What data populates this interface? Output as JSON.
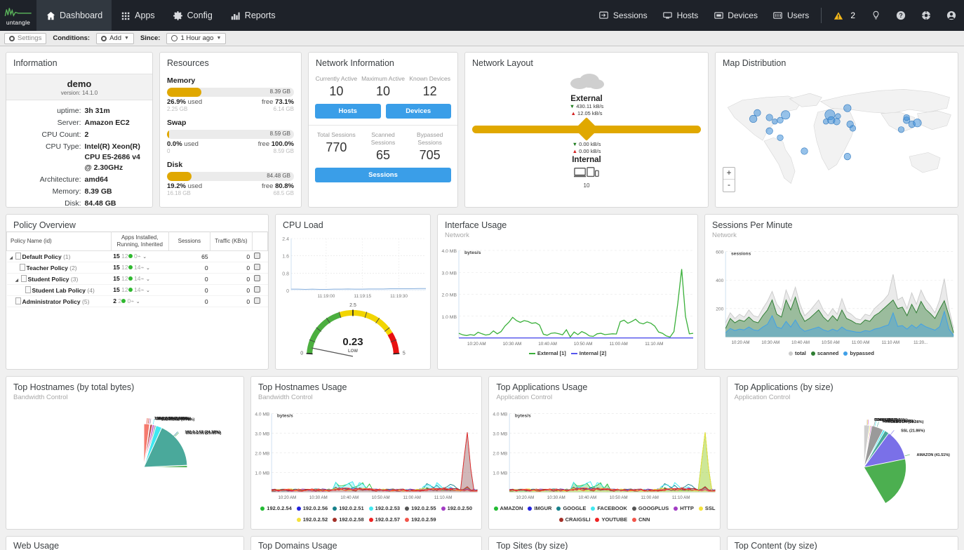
{
  "nav": {
    "brand": "untangle",
    "items": [
      {
        "label": "Dashboard",
        "icon": "home-icon",
        "active": true
      },
      {
        "label": "Apps",
        "icon": "grid-icon",
        "active": false
      },
      {
        "label": "Config",
        "icon": "gear-icon",
        "active": false
      },
      {
        "label": "Reports",
        "icon": "bars-icon",
        "active": false
      }
    ],
    "right_items": [
      {
        "label": "Sessions",
        "icon": "sessions-icon"
      },
      {
        "label": "Hosts",
        "icon": "hosts-icon"
      },
      {
        "label": "Devices",
        "icon": "devices-icon"
      },
      {
        "label": "Users",
        "icon": "users-icon"
      }
    ],
    "alert_count": "2",
    "alert_icon": "warning-icon",
    "bulb_icon": "lightbulb-icon",
    "help_icon": "question-icon",
    "support_icon": "lifering-icon",
    "account_icon": "account-icon"
  },
  "toolbar": {
    "settings_label": "Settings",
    "conditions_label": "Conditions:",
    "add_label": "Add",
    "since_label": "Since:",
    "since_value": "1 Hour ago"
  },
  "information": {
    "title": "Information",
    "hostname": "demo",
    "version": "version: 14.1.0",
    "rows": [
      {
        "key": "uptime:",
        "value": "3h 31m"
      },
      {
        "key": "Server:",
        "value": "Amazon EC2"
      },
      {
        "key": "CPU Count:",
        "value": "2"
      },
      {
        "key": "CPU Type:",
        "value": "Intel(R) Xeon(R) CPU E5-2686 v4 @ 2.30GHz"
      },
      {
        "key": "Architecture:",
        "value": "amd64"
      },
      {
        "key": "Memory:",
        "value": "8.39 GB"
      },
      {
        "key": "Disk:",
        "value": "84.48 GB"
      }
    ]
  },
  "resources": {
    "title": "Resources",
    "groups": [
      {
        "name": "Memory",
        "total": "8.39 GB",
        "pct": 26.9,
        "used_pct": "26.9%",
        "used_word": "used",
        "free_word": "free",
        "free_pct": "73.1%",
        "used_abs": "2.25 GB",
        "free_abs": "6.14 GB"
      },
      {
        "name": "Swap",
        "total": "8.59 GB",
        "pct": 0.0,
        "used_pct": "0.0%",
        "used_word": "used",
        "free_word": "free",
        "free_pct": "100.0%",
        "used_abs": "0",
        "free_abs": "8.59 GB"
      },
      {
        "name": "Disk",
        "total": "84.48 GB",
        "pct": 19.2,
        "used_pct": "19.2%",
        "used_word": "used",
        "free_word": "free",
        "free_pct": "80.8%",
        "used_abs": "16.18 GB",
        "free_abs": "68.5 GB"
      }
    ]
  },
  "network_information": {
    "title": "Network Information",
    "top_stats": [
      {
        "label": "Currently Active",
        "value": "10"
      },
      {
        "label": "Maximum Active",
        "value": "10"
      },
      {
        "label": "Known Devices",
        "value": "12"
      }
    ],
    "hosts_button": "Hosts",
    "devices_button": "Devices",
    "bottom_stats": [
      {
        "label": "Total Sessions",
        "value": "770"
      },
      {
        "label": "Scanned Sessions",
        "value": "65"
      },
      {
        "label": "Bypassed Sessions",
        "value": "705"
      }
    ],
    "sessions_button": "Sessions"
  },
  "network_layout": {
    "title": "Network Layout",
    "external_label": "External",
    "external_down": "430.11 kB/s",
    "external_up": "12.05 kB/s",
    "internal_label": "Internal",
    "internal_down": "0.00 kB/s",
    "internal_up": "0.00 kB/s",
    "device_count": "10",
    "cloud_icon": "cloud-icon",
    "devices_icon": "devices-icon"
  },
  "map": {
    "title": "Map Distribution",
    "zoom_in": "+",
    "zoom_out": "-"
  },
  "policy_overview": {
    "title": "Policy Overview",
    "columns": [
      "Policy Name (id)",
      "Apps Installed, Running, Inherited",
      "Sessions",
      "Traffic (KB/s)",
      ""
    ],
    "rows": [
      {
        "name": "Default Policy",
        "id": "(1)",
        "indent": 0,
        "expander": true,
        "installed": "15",
        "running": "12",
        "inherited": "0",
        "sessions": "65",
        "traffic": "0"
      },
      {
        "name": "Teacher Policy",
        "id": "(2)",
        "indent": 1,
        "expander": false,
        "installed": "15",
        "running": "12",
        "inherited": "14",
        "sessions": "0",
        "traffic": "0"
      },
      {
        "name": "Student Policy",
        "id": "(3)",
        "indent": 1,
        "expander": true,
        "installed": "15",
        "running": "12",
        "inherited": "14",
        "sessions": "0",
        "traffic": "0"
      },
      {
        "name": "Student Lab Policy",
        "id": "(4)",
        "indent": 2,
        "expander": false,
        "installed": "15",
        "running": "12",
        "inherited": "14",
        "sessions": "0",
        "traffic": "0"
      },
      {
        "name": "Administrator Policy",
        "id": "(5)",
        "indent": 0,
        "expander": false,
        "installed": "2",
        "running": "2",
        "inherited": "0",
        "sessions": "0",
        "traffic": "0"
      }
    ]
  },
  "cpu_load": {
    "title": "CPU Load",
    "gauge_value": "0.23",
    "gauge_state": "LOW",
    "gauge_ticks": [
      "0",
      "2.5",
      "5"
    ]
  },
  "interface_usage": {
    "title": "Interface Usage",
    "subtitle": "Network"
  },
  "sessions_per_minute": {
    "title": "Sessions Per Minute",
    "subtitle": "Network"
  },
  "top_hostnames_pie": {
    "title": "Top Hostnames (by total bytes)",
    "subtitle": "Bandwidth Control"
  },
  "top_hostnames_usage": {
    "title": "Top Hostnames Usage",
    "subtitle": "Bandwidth Control"
  },
  "top_applications_usage": {
    "title": "Top Applications Usage",
    "subtitle": "Application Control"
  },
  "top_applications_pie": {
    "title": "Top Applications (by size)",
    "subtitle": "Application Control"
  },
  "bottom_row": [
    {
      "title": "Web Usage"
    },
    {
      "title": "Top Domains Usage"
    },
    {
      "title": "Top Sites (by size)"
    },
    {
      "title": "Top Content (by size)"
    }
  ],
  "chart_data": [
    {
      "id": "cpu_load_line",
      "type": "line",
      "title": "CPU Load",
      "ylabel": "",
      "ylim": [
        0,
        2.4
      ],
      "yticks": [
        0,
        0.8,
        1.6,
        2.4
      ],
      "ytick_labels": [
        "0",
        "0.8",
        "1.6",
        "2.4"
      ],
      "xtick_labels": [
        "11:19:00",
        "11:19:15",
        "11:19:30"
      ],
      "series": [
        {
          "name": "load",
          "color": "#7fa8d8",
          "values": [
            0.06,
            0.06,
            0.05,
            0.06,
            0.05,
            0.05,
            0.06,
            0.06,
            0.07,
            0.06,
            0.06,
            0.07,
            0.07,
            0.07,
            0.08,
            0.08,
            0.08,
            0.08,
            0.09,
            0.09
          ]
        }
      ],
      "grid": true
    },
    {
      "id": "cpu_load_gauge",
      "type": "gauge",
      "title": "CPU Load Gauge",
      "value": 0.23,
      "value_label": "0.23",
      "state": "LOW",
      "min": 0,
      "max": 5,
      "ticks": [
        0,
        2.5,
        5
      ],
      "bands": [
        {
          "from": 0,
          "to": 2.0,
          "color": "#4caf3f"
        },
        {
          "from": 2.0,
          "to": 4.2,
          "color": "#f2d500"
        },
        {
          "from": 4.2,
          "to": 5,
          "color": "#e81010"
        }
      ]
    },
    {
      "id": "interface_usage",
      "type": "line",
      "title": "Interface Usage",
      "subtitle": "Network",
      "ylabel": "bytes/s",
      "ylim": [
        0,
        4000000
      ],
      "ytick_labels": [
        "1.0 MB",
        "2.0 MB",
        "3.0 MB",
        "4.0 MB"
      ],
      "xtick_labels": [
        "10:20 AM",
        "10:30 AM",
        "10:40 AM",
        "10:50 AM",
        "11:00 AM",
        "11:10 AM"
      ],
      "legend_position": "bottom",
      "series": [
        {
          "name": "External [1]",
          "color": "#3ab03a",
          "values": [
            0.22,
            0.15,
            0.12,
            0.16,
            0.13,
            0.27,
            0.2,
            0.14,
            0.17,
            0.33,
            0.2,
            0.3,
            0.55,
            0.72,
            0.95,
            0.8,
            0.72,
            0.8,
            0.76,
            0.68,
            0.7,
            0.6,
            0.18,
            0.13,
            0.22,
            0.24,
            0.2,
            0.15,
            0.38,
            0.05,
            0.28,
            0.16,
            0.3,
            0.22,
            0.1,
            0.08,
            0.2,
            0.22,
            0.16,
            0.18,
            0.2,
            0.19,
            0.75,
            0.82,
            0.68,
            0.76,
            0.86,
            0.7,
            0.65,
            0.74,
            0.68,
            0.55,
            0.28,
            0.22,
            0.1,
            0.05,
            0.3,
            1.6,
            3.15,
            1.0,
            0.2,
            0.22
          ]
        },
        {
          "name": "Internal [2]",
          "color": "#5555ee",
          "values": [
            0.01,
            0.01,
            0.01,
            0.01,
            0.01,
            0.01,
            0.01,
            0.01,
            0.01,
            0.01,
            0.01,
            0.01,
            0.01,
            0.01,
            0.01,
            0.01,
            0.01,
            0.01,
            0.01,
            0.01,
            0.01,
            0.01,
            0.01,
            0.01,
            0.01,
            0.01,
            0.01,
            0.01,
            0.01,
            0.01,
            0.01,
            0.01,
            0.01,
            0.01,
            0.01,
            0.01,
            0.01,
            0.01,
            0.01,
            0.01,
            0.01,
            0.01,
            0.01,
            0.01,
            0.01,
            0.01,
            0.01,
            0.01,
            0.01,
            0.01,
            0.01,
            0.01,
            0.01,
            0.01,
            0.01,
            0.01,
            0.01,
            0.01,
            0.01,
            0.01,
            0.01,
            0.01
          ]
        }
      ]
    },
    {
      "id": "sessions_per_minute",
      "type": "area",
      "title": "Sessions Per Minute",
      "subtitle": "Network",
      "ylabel": "sessions",
      "ylim": [
        0,
        600
      ],
      "ytick_labels": [
        "200",
        "400",
        "600"
      ],
      "xtick_labels": [
        "10:20 AM",
        "10:30 AM",
        "10:40 AM",
        "10:50 AM",
        "11:00 AM",
        "11:10 AM",
        "11:20..."
      ],
      "legend_position": "bottom",
      "series": [
        {
          "name": "total",
          "color": "#cccccc",
          "values": [
            100,
            170,
            130,
            160,
            140,
            190,
            150,
            140,
            200,
            250,
            320,
            230,
            190,
            330,
            250,
            350,
            230,
            150,
            180,
            220,
            260,
            190,
            150,
            200,
            160,
            270,
            180,
            160,
            130,
            120,
            160,
            150,
            200,
            230,
            260,
            300,
            440,
            260,
            280,
            200,
            310,
            230,
            330,
            260,
            220,
            170,
            260,
            410,
            200,
            60
          ]
        },
        {
          "name": "scanned",
          "color": "#2e7d32",
          "values": [
            60,
            130,
            100,
            120,
            110,
            140,
            110,
            100,
            150,
            190,
            260,
            160,
            140,
            260,
            190,
            280,
            170,
            110,
            130,
            160,
            190,
            140,
            110,
            150,
            115,
            190,
            130,
            115,
            95,
            90,
            120,
            110,
            150,
            170,
            200,
            230,
            260,
            200,
            210,
            150,
            230,
            170,
            250,
            195,
            165,
            130,
            195,
            255,
            150,
            30
          ]
        },
        {
          "name": "bypassed",
          "color": "#3fa0e8",
          "values": [
            30,
            60,
            45,
            55,
            50,
            70,
            50,
            45,
            70,
            90,
            150,
            70,
            60,
            110,
            70,
            120,
            65,
            40,
            50,
            60,
            70,
            50,
            40,
            55,
            42,
            70,
            48,
            42,
            35,
            33,
            45,
            40,
            55,
            62,
            75,
            85,
            170,
            75,
            80,
            55,
            85,
            62,
            92,
            72,
            60,
            48,
            72,
            180,
            55,
            10
          ]
        }
      ]
    },
    {
      "id": "top_hostnames_pie",
      "type": "pie",
      "title": "Top Hostnames (by total bytes)",
      "subtitle": "Bandwidth Control",
      "slices": [
        {
          "label": "192.0.2.51",
          "pct": 25.15,
          "color": "#4caf50"
        },
        {
          "label": "192.0.2.57",
          "pct": 24.34,
          "color": "#7a70e8"
        },
        {
          "label": "192.0.2.53",
          "pct": 24.23,
          "color": "#4aa99b"
        },
        {
          "label": "192.0.2.52",
          "pct": 6.79,
          "color": "#3fe8f0"
        },
        {
          "label": "192.0.2.58",
          "pct": 4.58,
          "color": "#9a9a9a"
        },
        {
          "label": "192.0.2.50",
          "pct": 3.97,
          "color": "#cc55cc"
        },
        {
          "label": "192.0.2.56",
          "pct": 3.2,
          "color": "#f2e54a"
        },
        {
          "label": "192.0.2.55",
          "pct": 3.18,
          "color": "#b5413f"
        },
        {
          "label": "192.0.2.54",
          "pct": 2.32,
          "color": "#e8403a"
        },
        {
          "label": "192.0.2.59",
          "pct": 2.14,
          "color": "#f57a6e"
        }
      ]
    },
    {
      "id": "top_hostnames_usage",
      "type": "line",
      "title": "Top Hostnames Usage",
      "subtitle": "Bandwidth Control",
      "ylabel": "bytes/s",
      "ylim": [
        0,
        4000000
      ],
      "ytick_labels": [
        "1.0 MB",
        "2.0 MB",
        "3.0 MB",
        "4.0 MB"
      ],
      "xtick_labels": [
        "10:20 AM",
        "10:30 AM",
        "10:40 AM",
        "10:50 AM",
        "11:00 AM",
        "11:10 AM"
      ],
      "legend_position": "bottom",
      "series": [
        {
          "name": "192.0.2.54",
          "color": "#22bb33"
        },
        {
          "name": "192.0.2.56",
          "color": "#2222dd"
        },
        {
          "name": "192.0.2.51",
          "color": "#17808a"
        },
        {
          "name": "192.0.2.53",
          "color": "#40e8f0"
        },
        {
          "name": "192.0.2.55",
          "color": "#555555"
        },
        {
          "name": "192.0.2.50",
          "color": "#a23cc4"
        },
        {
          "name": "192.0.2.52",
          "color": "#f5e23a"
        },
        {
          "name": "192.0.2.58",
          "color": "#a33028"
        },
        {
          "name": "192.0.2.57",
          "color": "#ee2222"
        },
        {
          "name": "192.0.2.59",
          "color": "#f2554a"
        }
      ]
    },
    {
      "id": "top_applications_usage",
      "type": "line",
      "title": "Top Applications Usage",
      "subtitle": "Application Control",
      "ylabel": "bytes/s",
      "ylim": [
        0,
        4000000
      ],
      "ytick_labels": [
        "1.0 MB",
        "2.0 MB",
        "3.0 MB",
        "4.0 MB"
      ],
      "xtick_labels": [
        "10:20 AM",
        "10:30 AM",
        "10:40 AM",
        "10:50 AM",
        "11:00 AM",
        "11:10 AM"
      ],
      "legend_position": "bottom",
      "series": [
        {
          "name": "AMAZON",
          "color": "#22bb33"
        },
        {
          "name": "IMGUR",
          "color": "#2222dd"
        },
        {
          "name": "GOOGLE",
          "color": "#17808a"
        },
        {
          "name": "FACEBOOK",
          "color": "#40e8f0"
        },
        {
          "name": "GOOGPLUS",
          "color": "#555555"
        },
        {
          "name": "HTTP",
          "color": "#a23cc4"
        },
        {
          "name": "SSL",
          "color": "#f5e23a"
        },
        {
          "name": "CRAIGSLI",
          "color": "#a33028"
        },
        {
          "name": "YOUTUBE",
          "color": "#ee2222"
        },
        {
          "name": "CNN",
          "color": "#f2554a"
        }
      ]
    },
    {
      "id": "top_applications_pie",
      "type": "pie",
      "title": "Top Applications (by size)",
      "subtitle": "Application Control",
      "slices": [
        {
          "label": "AMAZON",
          "pct": 41.51,
          "color": "#4caf50"
        },
        {
          "label": "SSL",
          "pct": 21.86,
          "color": "#7a70e8"
        },
        {
          "label": "FACEBOOK",
          "pct": 10.08,
          "color": "#4aa99b"
        },
        {
          "label": "CRAIGSLI",
          "pct": 8.33,
          "color": "#3fe8f0"
        },
        {
          "label": "GOOGLE",
          "pct": 7.62,
          "color": "#9a9a9a"
        },
        {
          "label": "CNN",
          "pct": 3.04,
          "color": "#cc55cc"
        },
        {
          "label": "YOUTUBE",
          "pct": 2.6,
          "color": "#f2e54a"
        },
        {
          "label": "HTTP",
          "pct": 1.9,
          "color": "#b5413f"
        },
        {
          "label": "IMGUR",
          "pct": 1.0,
          "color": "#e8403a"
        },
        {
          "label": "Others",
          "pct": 2.17,
          "color": "#cfcfcf"
        }
      ],
      "visible_labels": [
        {
          "label": "AMAZON",
          "pct": "41.51%"
        },
        {
          "label": "SSL",
          "pct": "21.86%"
        },
        {
          "label": "FACEBOOK",
          "pct": "10.08%"
        },
        {
          "label": "CRAIGSLI",
          "pct": "8.33%"
        },
        {
          "label": "GOOGLE",
          "pct": "7.62%"
        },
        {
          "label": "CNN",
          "pct": "3.04%"
        },
        {
          "label": "Others",
          "pct": "2.17%"
        }
      ]
    }
  ]
}
